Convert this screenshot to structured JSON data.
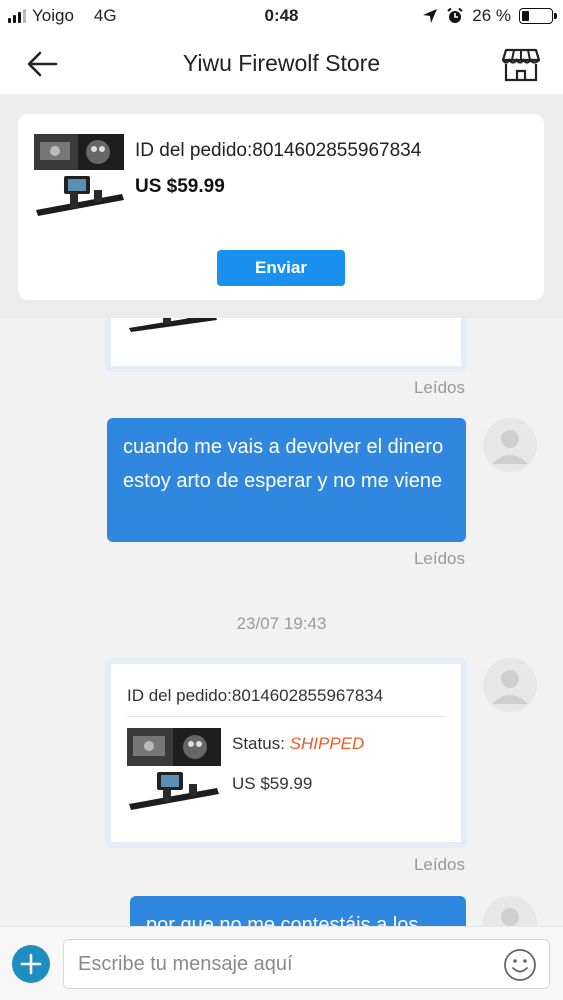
{
  "status_bar": {
    "carrier": "Yoigo",
    "network": "4G",
    "time": "0:48",
    "battery_percent": "26 %",
    "battery_level": 0.26
  },
  "header": {
    "title": "Yiwu Firewolf Store",
    "back_icon": "back-arrow-icon",
    "store_icon": "store-icon"
  },
  "order_banner": {
    "order_id": "ID del pedido:8014602855967834",
    "price": "US $59.99",
    "send_label": "Enviar"
  },
  "chat": {
    "messages": [
      {
        "type": "order_card_partial",
        "status": "Leídos"
      },
      {
        "type": "text",
        "text": "cuando me vais a devolver el dinero estoy arto de esperar y no me viene",
        "status": "Leídos"
      },
      {
        "type": "timestamp",
        "text": "23/07 19:43"
      },
      {
        "type": "order_card",
        "order_id": "ID del pedido:8014602855967834",
        "status_label": "Status:",
        "status_value": "SHIPPED",
        "price": "US $59.99",
        "status": "Leídos"
      },
      {
        "type": "text_partial",
        "text": "por que no me contestáis a los"
      }
    ]
  },
  "composer": {
    "placeholder": "Escribe tu mensaje aquí"
  },
  "colors": {
    "accent": "#1a91ee",
    "bubble": "#2f87e0",
    "shipped": "#f05a28",
    "add_button": "#1f8dbf"
  }
}
